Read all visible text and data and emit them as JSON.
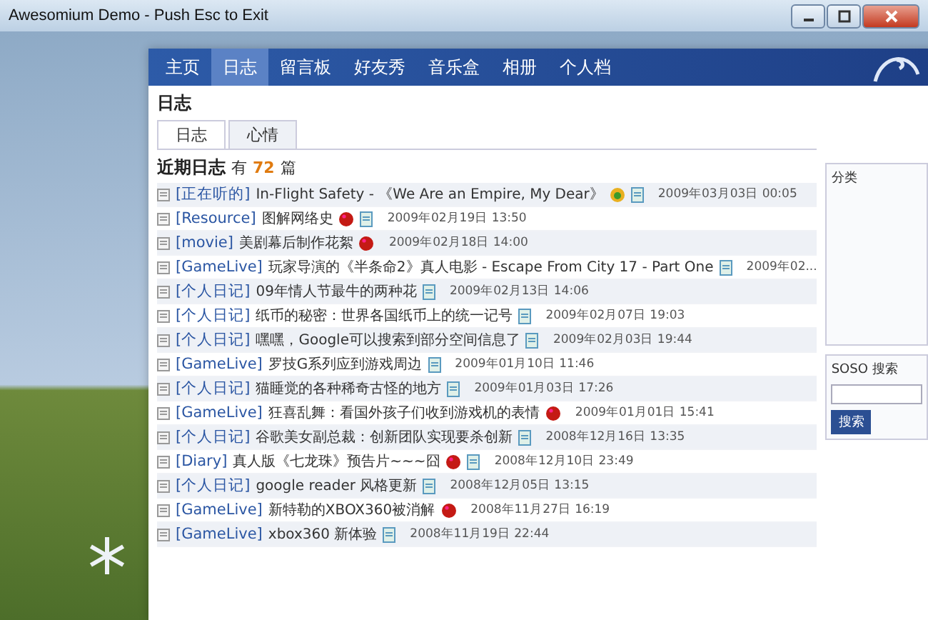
{
  "window": {
    "title": "Awesomium Demo - Push Esc to Exit"
  },
  "nav": [
    {
      "label": "主页",
      "selected": false
    },
    {
      "label": "日志",
      "selected": true
    },
    {
      "label": "留言板",
      "selected": false
    },
    {
      "label": "好友秀",
      "selected": false
    },
    {
      "label": "音乐盒",
      "selected": false
    },
    {
      "label": "相册",
      "selected": false
    },
    {
      "label": "个人档",
      "selected": false
    }
  ],
  "section_title": "日志",
  "subtabs": [
    {
      "label": "日志",
      "selected": true
    },
    {
      "label": "心情",
      "selected": false
    }
  ],
  "heading": {
    "text": "近期日志",
    "prefix": "有",
    "count": "72",
    "suffix": "篇"
  },
  "posts": [
    {
      "category": "[正在听的]",
      "title": "In-Flight Safety - 《We Are an Empire, My Dear》",
      "hot": false,
      "music": true,
      "doc": true,
      "date": "2009年03月03日 00:05"
    },
    {
      "category": "[Resource]",
      "title": "图解网络史",
      "hot": true,
      "music": false,
      "doc": true,
      "date": "2009年02月19日 13:50"
    },
    {
      "category": "[movie]",
      "title": "美剧幕后制作花絮",
      "hot": true,
      "music": false,
      "doc": false,
      "date": "2009年02月18日 14:00"
    },
    {
      "category": "[GameLive]",
      "title": "玩家导演的《半条命2》真人电影 - Escape From City 17 - Part One",
      "hot": false,
      "music": false,
      "doc": true,
      "date": "2009年02..."
    },
    {
      "category": "[个人日记]",
      "title": "09年情人节最牛的两种花",
      "hot": false,
      "music": false,
      "doc": true,
      "date": "2009年02月13日 14:06"
    },
    {
      "category": "[个人日记]",
      "title": "纸币的秘密：世界各国纸币上的统一记号",
      "hot": false,
      "music": false,
      "doc": true,
      "date": "2009年02月07日 19:03"
    },
    {
      "category": "[个人日记]",
      "title": "嘿嘿，Google可以搜索到部分空间信息了",
      "hot": false,
      "music": false,
      "doc": true,
      "date": "2009年02月03日 19:44"
    },
    {
      "category": "[GameLive]",
      "title": "罗技G系列应到游戏周边",
      "hot": false,
      "music": false,
      "doc": true,
      "date": "2009年01月10日 11:46"
    },
    {
      "category": "[个人日记]",
      "title": "猫睡觉的各种稀奇古怪的地方",
      "hot": false,
      "music": false,
      "doc": true,
      "date": "2009年01月03日 17:26"
    },
    {
      "category": "[GameLive]",
      "title": "狂喜乱舞：看国外孩子们收到游戏机的表情",
      "hot": true,
      "music": false,
      "doc": false,
      "date": "2009年01月01日 15:41"
    },
    {
      "category": "[个人日记]",
      "title": "谷歌美女副总裁：创新团队实现要杀创新",
      "hot": false,
      "music": false,
      "doc": true,
      "date": "2008年12月16日 13:35"
    },
    {
      "category": "[Diary]",
      "title": "真人版《七龙珠》预告片~~~囧",
      "hot": true,
      "music": false,
      "doc": true,
      "date": "2008年12月10日 23:49"
    },
    {
      "category": "[个人日记]",
      "title": "google reader 风格更新",
      "hot": false,
      "music": false,
      "doc": true,
      "date": "2008年12月05日 13:15"
    },
    {
      "category": "[GameLive]",
      "title": "新特勒的XBOX360被消解",
      "hot": true,
      "music": false,
      "doc": false,
      "date": "2008年11月27日 16:19"
    },
    {
      "category": "[GameLive]",
      "title": "xbox360 新体验",
      "hot": false,
      "music": false,
      "doc": true,
      "date": "2008年11月19日 22:44"
    }
  ],
  "sidebar": {
    "category_title": "分类",
    "search_title": "SOSO 搜索",
    "search_button": "搜索"
  }
}
